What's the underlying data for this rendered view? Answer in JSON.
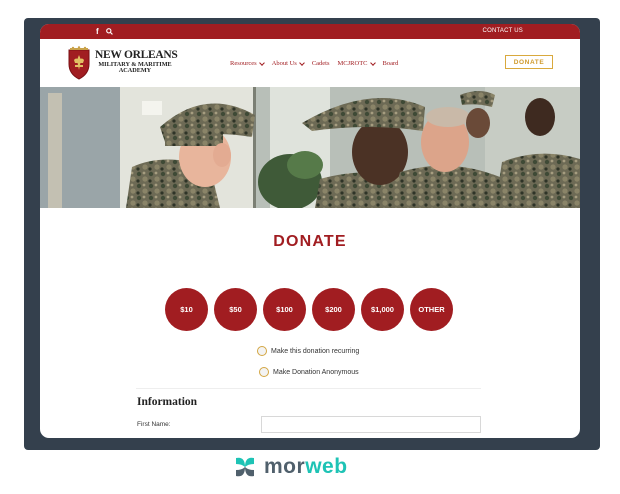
{
  "topbar": {
    "facebook_icon": "f",
    "search_icon": "search-icon",
    "contact_label": "CONTACT US"
  },
  "logo": {
    "line1": "NEW ORLEANS",
    "line2": "MILITARY & MARITIME",
    "line3": "ACADEMY"
  },
  "nav": {
    "items": [
      {
        "label": "Resources",
        "dropdown": true
      },
      {
        "label": "About Us",
        "dropdown": true
      },
      {
        "label": "Cadets",
        "dropdown": false
      },
      {
        "label": "MCJROTC",
        "dropdown": true
      },
      {
        "label": "Board",
        "dropdown": false
      }
    ],
    "donate_label": "DONATE"
  },
  "main": {
    "title": "DONATE",
    "amounts": [
      "$10",
      "$50",
      "$100",
      "$200",
      "$1,000",
      "OTHER"
    ],
    "recurring_label": "Make this donation recurring",
    "anonymous_label": "Make Donation Anonymous",
    "info_heading": "Information",
    "first_name_label": "First Name:",
    "first_name_value": ""
  },
  "brand": {
    "part1": "mor",
    "part2": "web"
  },
  "colors": {
    "primary": "#a11d21",
    "accent": "#d09a2c",
    "frame": "#34404d",
    "brand_teal": "#1ec3b5"
  }
}
